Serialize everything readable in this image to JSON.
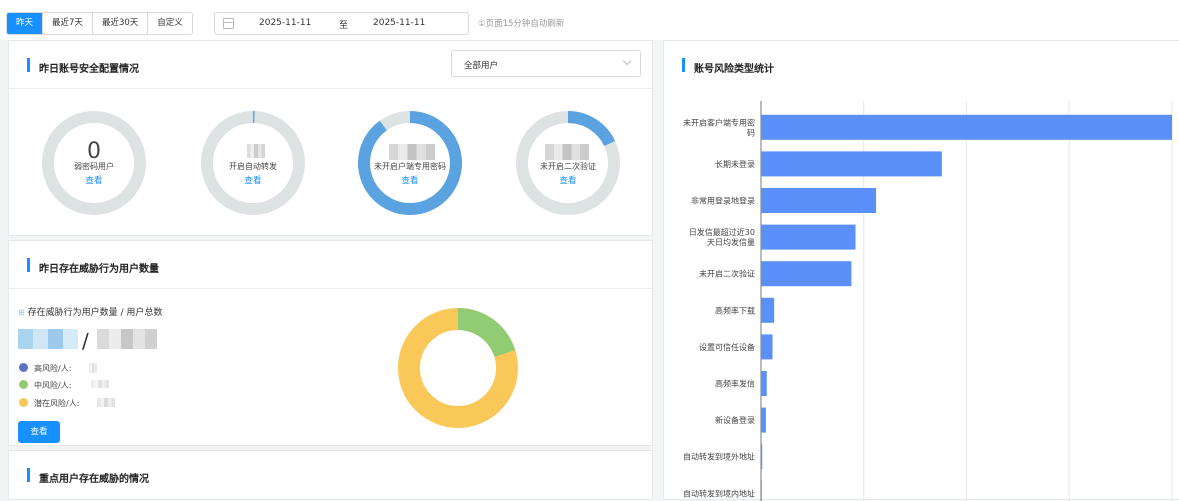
{
  "toolbar": {
    "tabs": [
      "昨天",
      "最近7天",
      "最近30天",
      "自定义"
    ],
    "active_tab": "昨天",
    "date_start": "2025-11-11",
    "date_sep": "至",
    "date_end": "2025-11-11",
    "refresh_note": "①页面15分钟自动刷新"
  },
  "security_config": {
    "title": "昨日账号安全配置情况",
    "user_filter": "全部用户",
    "gauges": [
      {
        "value": "0",
        "label": "弱密码用户",
        "link": "查看",
        "fraction": 0.0
      },
      {
        "value": "",
        "label": "开启自动转发",
        "link": "查看",
        "fraction": 0.005
      },
      {
        "value": "",
        "label": "未开启户端专用密码",
        "link": "查看",
        "fraction": 0.9
      },
      {
        "value": "",
        "label": "未开启二次验证",
        "link": "查看",
        "fraction": 0.18
      }
    ]
  },
  "threat_users": {
    "title": "昨日存在威胁行为用户数量",
    "subtitle": "存在威胁行为用户数量 / 用户总数",
    "separator": "/",
    "legend": [
      {
        "label": "高风险/人:",
        "color": "#5b6fc7"
      },
      {
        "label": "中风险/人:",
        "color": "#91cc75"
      },
      {
        "label": "潜在风险/人:",
        "color": "#f9c859"
      }
    ],
    "button": "查看"
  },
  "key_users": {
    "title": "重点用户存在威胁的情况"
  },
  "risk_stats": {
    "title": "账号风险类型统计"
  },
  "chart_data": {
    "type": "bar",
    "orientation": "horizontal",
    "categories": [
      "未开启客户端专用密码",
      "长期未登录",
      "非常用登录地登录",
      "日发信最超过近30天日均发信量",
      "未开启二次验证",
      "高频率下载",
      "设置可信任设备",
      "高频率发信",
      "新设备登录",
      "自动转发到境外地址",
      "自动转发到境内地址"
    ],
    "values": [
      100,
      44,
      28,
      23,
      22,
      3.2,
      2.8,
      1.4,
      1.2,
      0.3,
      0.2
    ],
    "bar_color": "#5b8ff9",
    "grid": true
  }
}
